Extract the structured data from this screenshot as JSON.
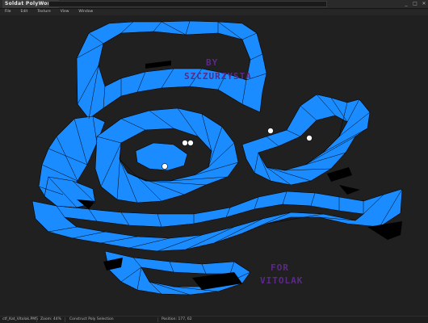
{
  "app": {
    "title": "Soldat PolyWorks"
  },
  "menu": [
    "File",
    "Edit",
    "Texture",
    "View",
    "Window"
  ],
  "map": {
    "text_top_line1": "BY",
    "text_top_line2": "SZCZURZYSTA",
    "text_bottom_line1": "FOR",
    "text_bottom_line2": "VITOLAK",
    "polygon_color": "#1a8cff",
    "edge_color": "#000000",
    "text_color": "#5a2a86"
  },
  "status": {
    "file": "ctf_Kat_Vitolak.PMS",
    "zoom": "Zoom: 44%",
    "mode": "Construct Poly Selection",
    "position": "Position: 177, 62"
  }
}
